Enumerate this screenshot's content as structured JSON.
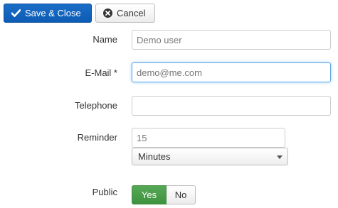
{
  "toolbar": {
    "save_label": "Save & Close",
    "save_icon": "check-icon",
    "cancel_label": "Cancel",
    "cancel_icon": "cancel-circle-icon"
  },
  "form": {
    "name": {
      "label": "Name",
      "value": "Demo user"
    },
    "email": {
      "label": "E-Mail *",
      "value": "demo@me.com"
    },
    "telephone": {
      "label": "Telephone",
      "value": ""
    },
    "reminder": {
      "label": "Reminder",
      "value": "15",
      "unit_selected": "Minutes"
    },
    "public": {
      "label": "Public",
      "yes": "Yes",
      "no": "No",
      "selected": "Yes"
    }
  },
  "colors": {
    "primary": "#0d5cb6",
    "success": "#46a046",
    "focus_border": "#5ea6e8"
  }
}
